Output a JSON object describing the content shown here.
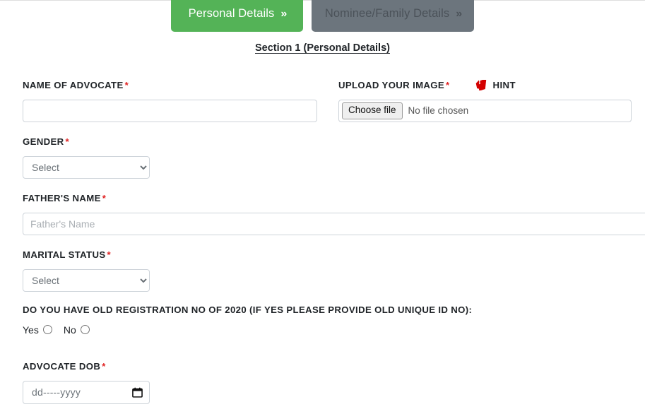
{
  "steps": [
    {
      "label": "Personal Details",
      "chevron": "»",
      "state": "active",
      "color": "#54b357"
    },
    {
      "label": "Nominee/Family Details",
      "chevron": "»",
      "state": "inactive",
      "color": "#6c757d"
    }
  ],
  "section": {
    "title": "Section 1 (Personal Details)"
  },
  "fields": {
    "name_of_advocate": {
      "label": "NAME OF ADVOCATE",
      "required": "*",
      "value": "",
      "placeholder": ""
    },
    "upload_your_image": {
      "label": "UPLOAD YOUR IMAGE",
      "required": "*",
      "hint_label": "HINT",
      "choose_file_label": "Choose file",
      "file_status": "No file chosen"
    },
    "gender": {
      "label": "GENDER",
      "required": "*",
      "selected": "Select",
      "options": [
        "Select"
      ]
    },
    "fathers_name": {
      "label": "FATHER'S NAME",
      "required": "*",
      "value": "",
      "placeholder": "Father's Name"
    },
    "marital_status": {
      "label": "MARITAL STATUS",
      "required": "*",
      "selected": "Select",
      "options": [
        "Select"
      ]
    },
    "old_registration": {
      "label": "DO YOU HAVE OLD REGISTRATION NO OF 2020 (IF YES PLEASE PROVIDE OLD UNIQUE ID NO):",
      "required": "",
      "yes_label": "Yes",
      "no_label": "No",
      "selected": ""
    },
    "advocate_dob": {
      "label": "ADVOCATE DOB",
      "required": "*",
      "value": "dd-----yyyy"
    }
  },
  "colors": {
    "accent_green": "#54b357",
    "muted_gray": "#6c757d",
    "required_red": "#e02424",
    "hint_icon_red": "#d40000"
  }
}
